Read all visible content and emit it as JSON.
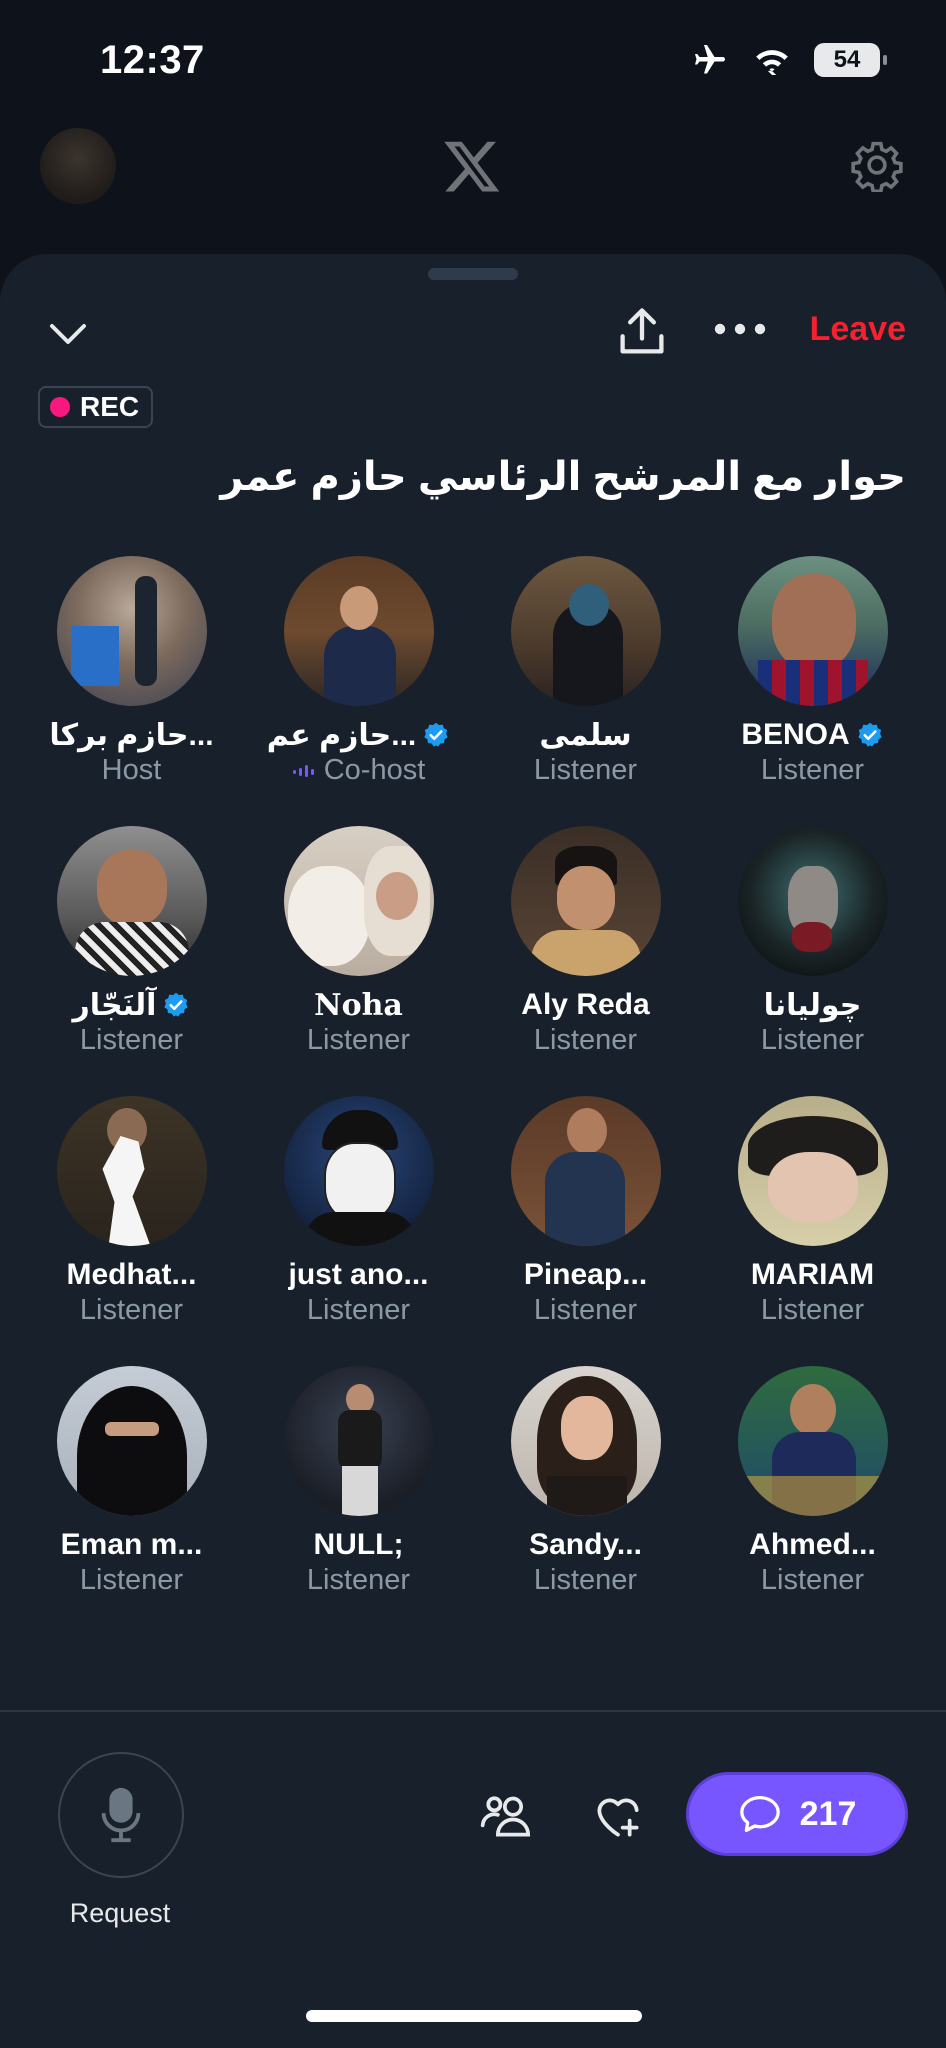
{
  "status_bar": {
    "time": "12:37",
    "battery": "54"
  },
  "sheet": {
    "leave_label": "Leave",
    "rec_label": "REC",
    "title": "حوار مع المرشح الرئاسي حازم عمر"
  },
  "participants": [
    {
      "name": "حازم بركا...",
      "role": "Host",
      "verified": false
    },
    {
      "name": "حازم عم...",
      "role": "Co-host",
      "verified": true
    },
    {
      "name": "سلمى",
      "role": "Listener",
      "verified": false
    },
    {
      "name": "BENOA",
      "role": "Listener",
      "verified": true
    },
    {
      "name": "آلنَجّار",
      "role": "Listener",
      "verified": true
    },
    {
      "name": "Noha",
      "role": "Listener",
      "verified": false
    },
    {
      "name": "Aly Reda",
      "role": "Listener",
      "verified": false
    },
    {
      "name": "چوليانا",
      "role": "Listener",
      "verified": false
    },
    {
      "name": "Medhat...",
      "role": "Listener",
      "verified": false
    },
    {
      "name": "just ano...",
      "role": "Listener",
      "verified": false
    },
    {
      "name": "Pineap...",
      "role": "Listener",
      "verified": false
    },
    {
      "name": "MARIAM",
      "role": "Listener",
      "verified": false
    },
    {
      "name": "Eman m...",
      "role": "Listener",
      "verified": false
    },
    {
      "name": "NULL;",
      "role": "Listener",
      "verified": false
    },
    {
      "name": "Sandy...",
      "role": "Listener",
      "verified": false
    },
    {
      "name": "Ahmed...",
      "role": "Listener",
      "verified": false
    }
  ],
  "bottom": {
    "request_label": "Request",
    "comments_count": "217"
  },
  "colors": {
    "accent": "#7856ff",
    "leave": "#f4212e",
    "rec_dot": "#f91880",
    "verified": "#1d9bf0"
  }
}
